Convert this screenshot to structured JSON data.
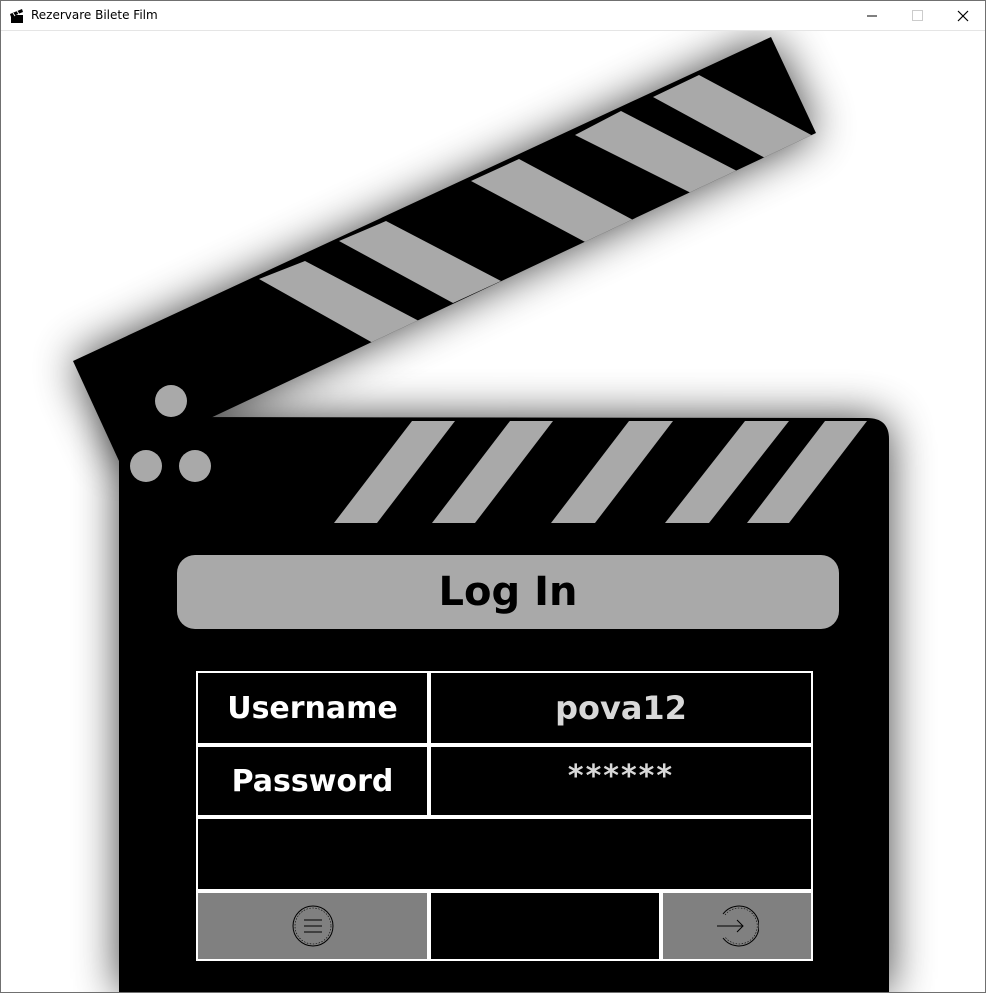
{
  "window": {
    "title": "Rezervare Bilete Film",
    "icon": "clapperboard-icon"
  },
  "controls": {
    "minimize_icon": "minimize-icon",
    "maximize_icon": "maximize-icon",
    "close_icon": "close-icon"
  },
  "login": {
    "title": "Log In",
    "username_label": "Username",
    "username_value": "pova12",
    "password_label": "Password",
    "password_value": "******",
    "menu_icon": "menu-icon",
    "enter_icon": "arrow-right-icon"
  },
  "colors": {
    "board": "#000000",
    "stripe": "#a9a9a9",
    "button": "#808080",
    "border": "#ffffff"
  }
}
